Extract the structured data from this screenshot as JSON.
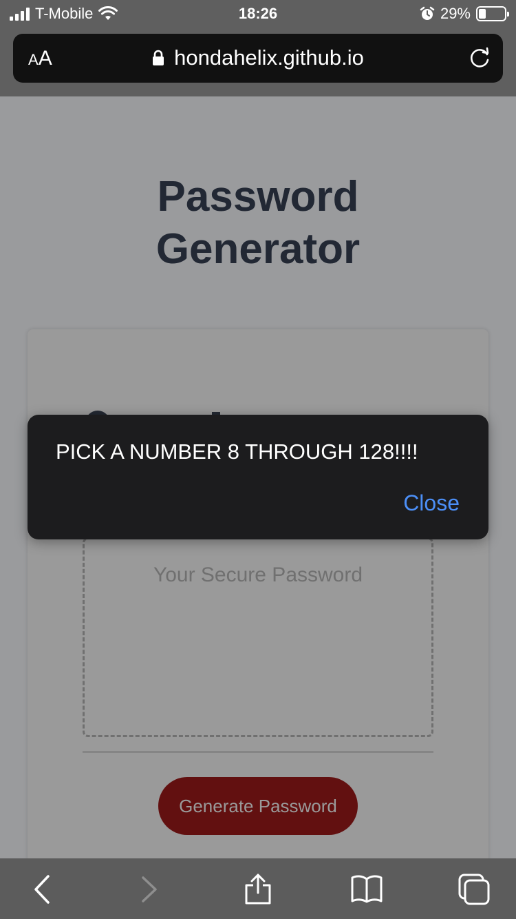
{
  "status_bar": {
    "carrier": "T-Mobile",
    "time": "18:26",
    "battery_percent": "29%",
    "battery_level": 0.29,
    "icons": [
      "signal-icon",
      "wifi-icon",
      "alarm-icon",
      "battery-icon"
    ]
  },
  "browser": {
    "text_size_label_small": "A",
    "text_size_label_large": "A",
    "url": "hondahelix.github.io",
    "icons": [
      "lock-icon",
      "reload-icon",
      "back-icon",
      "forward-icon",
      "share-icon",
      "bookmarks-icon",
      "tabs-icon"
    ]
  },
  "page": {
    "title_line1": "Password",
    "title_line2": "Generator",
    "password_placeholder": "Your Secure Password",
    "generate_button": "Generate Password"
  },
  "alert": {
    "message": "PICK A NUMBER 8 THROUGH 128!!!!",
    "close_label": "Close"
  },
  "colors": {
    "alert_link": "#4c8ff7",
    "button": "#621010",
    "title": "#222834"
  }
}
